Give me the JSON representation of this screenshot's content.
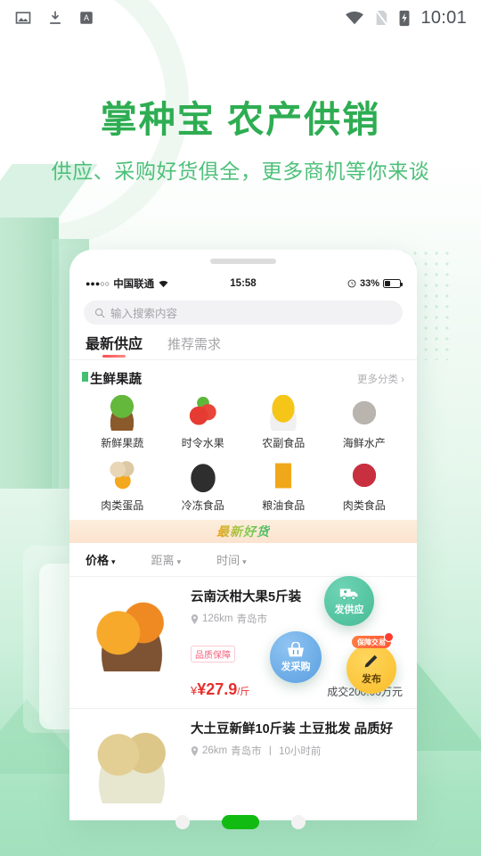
{
  "system_status_bar": {
    "icons": [
      "image-icon",
      "download-icon",
      "translate-icon"
    ],
    "wifi": "wifi-icon",
    "sim": "sim-off-icon",
    "battery": "battery-charging-icon",
    "clock": "10:01"
  },
  "headline": {
    "title": "掌种宝 农产供销",
    "subtitle": "供应、采购好货俱全，更多商机等你来谈",
    "title_color": "#2ead52",
    "subtitle_color": "#4ec07a"
  },
  "phone": {
    "status": {
      "signal": "●●●○○",
      "carrier": "中国联通",
      "wifi": "wifi-icon",
      "time": "15:58",
      "alarm": "alarm-icon",
      "battery_pct": "33%"
    },
    "search": {
      "placeholder": "输入搜索内容",
      "icon": "search-icon"
    },
    "tabs": [
      {
        "label": "最新供应",
        "active": true
      },
      {
        "label": "推荐需求",
        "active": false
      }
    ],
    "category_section": {
      "title": "生鲜果蔬",
      "more_label": "更多分类",
      "more_icon": "chevron-right-icon",
      "items": [
        {
          "label": "新鲜果蔬",
          "icon": "vegetables-icon"
        },
        {
          "label": "时令水果",
          "icon": "strawberry-icon"
        },
        {
          "label": "农副食品",
          "icon": "grain-bowl-icon"
        },
        {
          "label": "海鲜水产",
          "icon": "seafood-icon"
        },
        {
          "label": "肉类蛋品",
          "icon": "eggs-icon"
        },
        {
          "label": "冷冻食品",
          "icon": "frozen-dumplings-icon"
        },
        {
          "label": "粮油食品",
          "icon": "cooking-oil-icon"
        },
        {
          "label": "肉类食品",
          "icon": "beef-icon"
        }
      ]
    },
    "promo_banner": {
      "text": "最新好货"
    },
    "filters": [
      {
        "label": "价格",
        "active": true,
        "caret": "▾"
      },
      {
        "label": "距离",
        "active": false,
        "caret": "▾"
      },
      {
        "label": "时间",
        "active": false,
        "caret": "▾"
      }
    ],
    "products": [
      {
        "title": "云南沃柑大果5斤装",
        "location_icon": "location-pin-icon",
        "distance": "126km",
        "city": "青岛市",
        "badge": "品质保障",
        "price": "¥27.9",
        "price_unit": "/斤",
        "deal": "成交200.00万元",
        "image": "oranges-image"
      },
      {
        "title": "大土豆新鲜10斤装 土豆批发 品质好",
        "location_icon": "location-pin-icon",
        "distance": "26km",
        "city": "青岛市",
        "time": "10小时前",
        "separator": "丨",
        "image": "potatoes-image"
      }
    ]
  },
  "fabs": [
    {
      "label": "发供应",
      "icon": "truck-icon",
      "color": "#46bb94"
    },
    {
      "label": "发采购",
      "icon": "basket-icon",
      "color": "#5a9fe0"
    },
    {
      "label": "发布",
      "icon": "pencil-icon",
      "color": "#f9bd28",
      "badge": "保障交易"
    }
  ],
  "pager": {
    "count": 3,
    "active_index": 1,
    "active_color": "#12bb12"
  }
}
